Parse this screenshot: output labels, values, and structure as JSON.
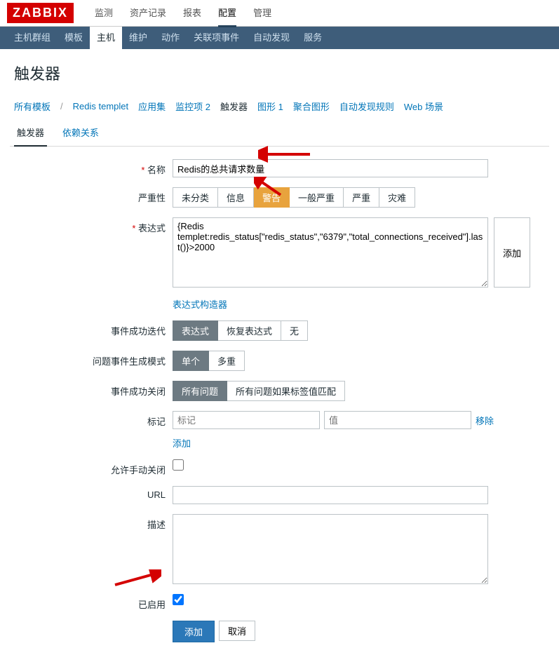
{
  "logo": "ZABBIX",
  "topnav": {
    "items": [
      "监测",
      "资产记录",
      "报表",
      "配置",
      "管理"
    ],
    "active": 3
  },
  "subnav": {
    "items": [
      "主机群组",
      "模板",
      "主机",
      "维护",
      "动作",
      "关联项事件",
      "自动发现",
      "服务"
    ],
    "active": 2
  },
  "page_title": "触发器",
  "crumbs": {
    "all_templates": "所有模板",
    "template": "Redis templet",
    "appset": "应用集",
    "monitor": "监控项 2",
    "trigger": "触发器",
    "graph": "图形 1",
    "aggregate": "聚合图形",
    "autodiscover": "自动发现规则",
    "web": "Web 场景"
  },
  "tabs": {
    "t1": "触发器",
    "t2": "依赖关系"
  },
  "form": {
    "name_label": "名称",
    "name_value": "Redis的总共请求数量",
    "severity_label": "严重性",
    "severity": {
      "o0": "未分类",
      "o1": "信息",
      "o2": "警告",
      "o3": "一般严重",
      "o4": "严重",
      "o5": "灾难"
    },
    "expression_label": "表达式",
    "expression_value": "{Redis templet:redis_status[\"redis_status\",\"6379\",\"total_connections_received\"].last()}>2000",
    "add_btn": "添加",
    "expr_builder": "表达式构造器",
    "event_gen_label": "事件成功迭代",
    "event_gen": {
      "o0": "表达式",
      "o1": "恢复表达式",
      "o2": "无"
    },
    "problem_mode_label": "问题事件生成模式",
    "problem_mode": {
      "o0": "单个",
      "o1": "多重"
    },
    "event_close_label": "事件成功关闭",
    "event_close": {
      "o0": "所有问题",
      "o1": "所有问题如果标签值匹配"
    },
    "tags_label": "标记",
    "tag_placeholder": "标记",
    "value_placeholder": "值",
    "remove": "移除",
    "add_link": "添加",
    "allow_manual_label": "允许手动关闭",
    "url_label": "URL",
    "url_value": "",
    "desc_label": "描述",
    "desc_value": "",
    "enabled_label": "已启用",
    "submit": "添加",
    "cancel": "取消"
  }
}
